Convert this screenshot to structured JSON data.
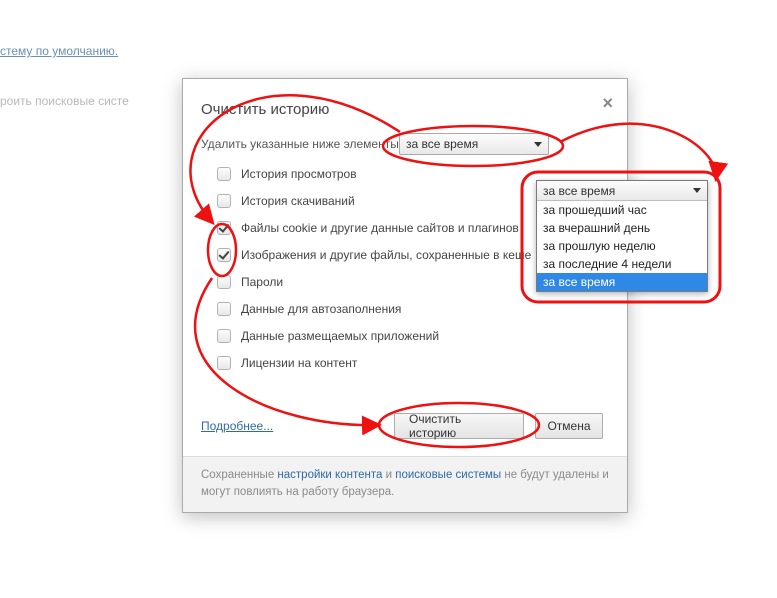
{
  "bg": {
    "link1": "стему по умолчанию.",
    "text1": "роить поисковые систе"
  },
  "dialog": {
    "title": "Очистить историю",
    "prompt": "Удалить указанные ниже элементы",
    "selected_range": "за все время",
    "options": [
      {
        "label": "История просмотров",
        "checked": false
      },
      {
        "label": "История скачиваний",
        "checked": false
      },
      {
        "label": "Файлы cookie и другие данные сайтов и плагинов",
        "checked": true
      },
      {
        "label": "Изображения и другие файлы, сохраненные в кеше",
        "checked": true
      },
      {
        "label": "Пароли",
        "checked": false
      },
      {
        "label": "Данные для автозаполнения",
        "checked": false
      },
      {
        "label": "Данные размещаемых приложений",
        "checked": false
      },
      {
        "label": "Лицензии на контент",
        "checked": false
      }
    ],
    "more_link": "Подробнее...",
    "primary_button": "Очистить историю",
    "cancel_button": "Отмена",
    "footer_pre": "Сохраненные ",
    "footer_link1": "настройки контента",
    "footer_mid": " и ",
    "footer_link2": "поисковые системы",
    "footer_post": " не будут удалены и могут повлиять на работу браузера."
  },
  "dropdown": {
    "selected": "за все время",
    "items": [
      "за прошедший час",
      "за вчерашний день",
      "за прошлую неделю",
      "за последние 4 недели",
      "за все время"
    ],
    "highlighted_index": 4
  }
}
